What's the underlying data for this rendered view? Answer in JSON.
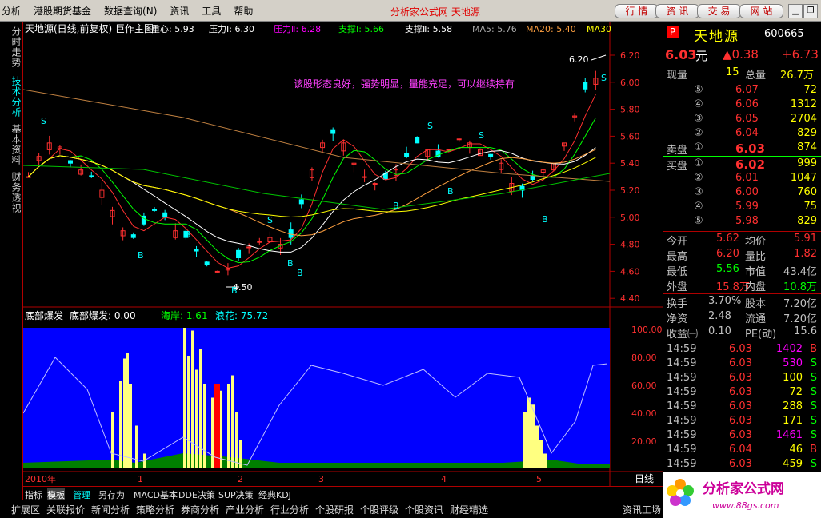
{
  "menu": [
    "分析",
    "港股期货基金",
    "数据查询(N)",
    "资讯",
    "工具",
    "帮助"
  ],
  "brand_text": "分析家公式网 天地源",
  "top_buttons": [
    "行 情",
    "资 讯",
    "交 易",
    "网 站"
  ],
  "side_tabs": [
    "分时走势",
    "技术分析",
    "基本资料",
    "财务透视"
  ],
  "main_header": {
    "title": "天地源(日线,前复权) 巨作主图",
    "items": [
      {
        "label": "重心: 5.93",
        "color": "#ffffff"
      },
      {
        "label": "压力Ⅰ: 6.30",
        "color": "#ffffff"
      },
      {
        "label": "压力Ⅱ: 6.28",
        "color": "#ff00ff"
      },
      {
        "label": "支撑Ⅰ: 5.66",
        "color": "#00ff00"
      },
      {
        "label": "支撑Ⅱ: 5.58",
        "color": "#ffffff"
      },
      {
        "label": "MA5: 5.76",
        "color": "#aaaaaa"
      },
      {
        "label": "MA20: 5.40",
        "color": "#ffa040"
      },
      {
        "label": "MA30",
        "color": "#ffff00"
      }
    ]
  },
  "annotation": "该股形态良好，强势明显，量能充足，可以继续持有",
  "price_axis": [
    "6.20",
    "6.00",
    "5.80",
    "5.60",
    "5.40",
    "5.20",
    "5.00",
    "4.80",
    "4.60",
    "4.40"
  ],
  "high_label": "6.20",
  "low_label": "4.50",
  "sub_header": {
    "name": "底部爆发",
    "item1": "底部爆发: 0.00",
    "item2": "海岸: 1.61",
    "item3": "浪花: 75.72"
  },
  "sub_axis": [
    "100.00",
    "80.00",
    "60.00",
    "40.00",
    "20.00"
  ],
  "x_axis": [
    "2010年",
    "1",
    "2",
    "3",
    "4",
    "5"
  ],
  "period": "日线",
  "chart_tabs": [
    "指标",
    "模板",
    "管理",
    "另存为",
    "MACD基本",
    "DDE决策",
    "SUP决策",
    "经典KDJ"
  ],
  "bottom_tabs": [
    "扩展区",
    "关联报价",
    "新闻分析",
    "策略分析",
    "券商分析",
    "产业分析",
    "行业分析",
    "个股研报",
    "个股评级",
    "个股资讯",
    "财经精选"
  ],
  "bottom_right": "资讯工场",
  "quote": {
    "badge": "P",
    "name": "天地源",
    "code": "600665",
    "price": "6.03",
    "unit": "元",
    "change": "▲0.38",
    "change_pct": "+6.73",
    "now_vol_label": "现量",
    "now_vol": "15",
    "total_vol_label": "总量",
    "total_vol": "26.7万",
    "sell": [
      {
        "lvl": "⑤",
        "price": "6.07",
        "vol": "72"
      },
      {
        "lvl": "④",
        "price": "6.06",
        "vol": "1312"
      },
      {
        "lvl": "③",
        "price": "6.05",
        "vol": "2704"
      },
      {
        "lvl": "②",
        "price": "6.04",
        "vol": "829"
      },
      {
        "lvl": "①",
        "price": "6.03",
        "vol": "874"
      }
    ],
    "sell_label": "卖盘",
    "buy_label": "买盘",
    "buy": [
      {
        "lvl": "①",
        "price": "6.02",
        "vol": "999"
      },
      {
        "lvl": "②",
        "price": "6.01",
        "vol": "1047"
      },
      {
        "lvl": "③",
        "price": "6.00",
        "vol": "760"
      },
      {
        "lvl": "④",
        "price": "5.99",
        "vol": "75"
      },
      {
        "lvl": "⑤",
        "price": "5.98",
        "vol": "829"
      }
    ],
    "stats": [
      {
        "l1": "今开",
        "v1": "5.62",
        "c1": "#ff3030",
        "l2": "均价",
        "v2": "5.91",
        "c2": "#ff3030"
      },
      {
        "l1": "最高",
        "v1": "6.20",
        "c1": "#ff3030",
        "l2": "量比",
        "v2": "1.82",
        "c2": "#ff3030"
      },
      {
        "l1": "最低",
        "v1": "5.56",
        "c1": "#00ff00",
        "l2": "市值",
        "v2": "43.4亿",
        "c2": "#c0c0c0"
      },
      {
        "l1": "外盘",
        "v1": "15.8万",
        "c1": "#ff3030",
        "l2": "内盘",
        "v2": "10.8万",
        "c2": "#00ff00"
      }
    ],
    "stats2": [
      {
        "l1": "换手",
        "v1": "3.70%",
        "l2": "股本",
        "v2": "7.20亿"
      },
      {
        "l1": "净资",
        "v1": "2.48",
        "l2": "流通",
        "v2": "7.20亿"
      },
      {
        "l1": "收益㈠",
        "v1": "0.10",
        "l2": "PE(动)",
        "v2": "15.6"
      }
    ],
    "ticks": [
      {
        "time": "14:59",
        "price": "6.03",
        "vol": "1402",
        "side": "B",
        "vc": "#ff00ff"
      },
      {
        "time": "14:59",
        "price": "6.03",
        "vol": "530",
        "side": "S",
        "vc": "#ff00ff"
      },
      {
        "time": "14:59",
        "price": "6.03",
        "vol": "100",
        "side": "S",
        "vc": "#ffff00"
      },
      {
        "time": "14:59",
        "price": "6.03",
        "vol": "72",
        "side": "S",
        "vc": "#ffff00"
      },
      {
        "time": "14:59",
        "price": "6.03",
        "vol": "288",
        "side": "S",
        "vc": "#ffff00"
      },
      {
        "time": "14:59",
        "price": "6.03",
        "vol": "171",
        "side": "S",
        "vc": "#ffff00"
      },
      {
        "time": "14:59",
        "price": "6.03",
        "vol": "1461",
        "side": "S",
        "vc": "#ff00ff"
      },
      {
        "time": "14:59",
        "price": "6.04",
        "vol": "46",
        "side": "B",
        "vc": "#ffff00"
      },
      {
        "time": "14:59",
        "price": "6.03",
        "vol": "459",
        "side": "S",
        "vc": "#ffff00"
      }
    ]
  },
  "logo_text": "分析家公式网",
  "logo_url": "www.88gs.com",
  "colors": {
    "up": "#ff3030",
    "down": "#00ffff",
    "sub_bg": "#0000ff",
    "axis": "#b00000"
  }
}
